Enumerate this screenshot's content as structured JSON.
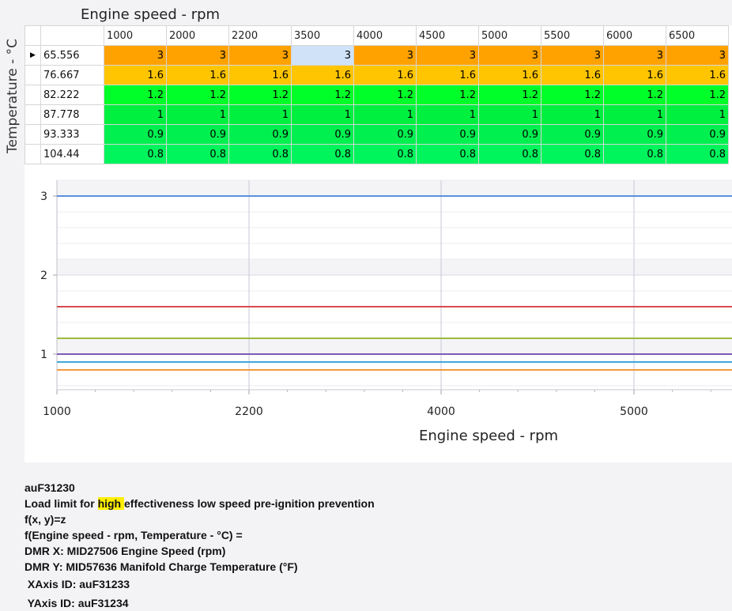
{
  "header": {
    "x_axis_title": "Engine speed - rpm",
    "y_axis_title": "Temperature - °C"
  },
  "grid": {
    "columns": [
      "1000",
      "2000",
      "2200",
      "3500",
      "4000",
      "4500",
      "5000",
      "5500",
      "6000",
      "6500"
    ],
    "rows": [
      {
        "label": "65.556",
        "values": [
          "3",
          "3",
          "3",
          "3",
          "3",
          "3",
          "3",
          "3",
          "3",
          "3"
        ],
        "color_class": "c-3",
        "current": true
      },
      {
        "label": "76.667",
        "values": [
          "1.6",
          "1.6",
          "1.6",
          "1.6",
          "1.6",
          "1.6",
          "1.6",
          "1.6",
          "1.6",
          "1.6"
        ],
        "color_class": "c-16"
      },
      {
        "label": "82.222",
        "values": [
          "1.2",
          "1.2",
          "1.2",
          "1.2",
          "1.2",
          "1.2",
          "1.2",
          "1.2",
          "1.2",
          "1.2"
        ],
        "color_class": "c-12"
      },
      {
        "label": "87.778",
        "values": [
          "1",
          "1",
          "1",
          "1",
          "1",
          "1",
          "1",
          "1",
          "1",
          "1"
        ],
        "color_class": "c-1"
      },
      {
        "label": "93.333",
        "values": [
          "0.9",
          "0.9",
          "0.9",
          "0.9",
          "0.9",
          "0.9",
          "0.9",
          "0.9",
          "0.9",
          "0.9"
        ],
        "color_class": "c-09"
      },
      {
        "label": "104.44",
        "values": [
          "0.8",
          "0.8",
          "0.8",
          "0.8",
          "0.8",
          "0.8",
          "0.8",
          "0.8",
          "0.8",
          "0.8"
        ],
        "color_class": "c-08"
      }
    ],
    "selected_cell": {
      "row": 0,
      "col": 3
    },
    "row_indicator_icon": "row-pointer-icon"
  },
  "chart_data": {
    "type": "line",
    "x_ticks": [
      "1000",
      "2200",
      "4000",
      "5000"
    ],
    "y_ticks": [
      "1",
      "2",
      "3"
    ],
    "xlabel": "Engine speed - rpm",
    "ylabel": "",
    "ylim": [
      0.55,
      3.2
    ],
    "series": [
      {
        "values": [
          3,
          3,
          3,
          3
        ],
        "color": "#5b8fdc"
      },
      {
        "values": [
          1.6,
          1.6,
          1.6,
          1.6
        ],
        "color": "#d84b4b"
      },
      {
        "values": [
          1.2,
          1.2,
          1.2,
          1.2
        ],
        "color": "#9bbb3e"
      },
      {
        "values": [
          1,
          1,
          1,
          1
        ],
        "color": "#7b5cb8"
      },
      {
        "values": [
          0.9,
          0.9,
          0.9,
          0.9
        ],
        "color": "#3fa8d8"
      },
      {
        "values": [
          0.8,
          0.8,
          0.8,
          0.8
        ],
        "color": "#f39a3c"
      }
    ]
  },
  "info": {
    "id": "auF31230",
    "desc_pre": "Load limit for ",
    "desc_highlight": "high ",
    "desc_post": "effectiveness low speed pre-ignition prevention",
    "formula": "f(x, y)=z",
    "formula_expanded": "f(Engine speed - rpm, Temperature - °C) =",
    "dmr_x": "DMR X: MID27506 Engine Speed (rpm)",
    "dmr_y": "DMR Y: MID57636 Manifold Charge Temperature (°F)",
    "xaxis_id": " XAxis ID: auF31233",
    "yaxis_id": " YAxis ID: auF31234"
  }
}
